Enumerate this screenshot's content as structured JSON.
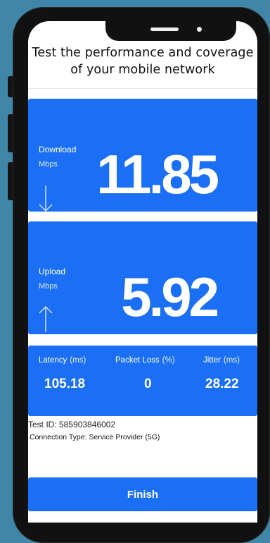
{
  "app": {
    "title": "Test the performance and coverage of your mobile network"
  },
  "download": {
    "label": "Download",
    "unit": "Mbps",
    "value": "11.85",
    "icon": "arrow-down-icon"
  },
  "upload": {
    "label": "Upload",
    "unit": "Mbps",
    "value": "5.92",
    "icon": "arrow-up-icon"
  },
  "stats": [
    {
      "label": "Latency",
      "unit": "(ms)",
      "value": "105.18"
    },
    {
      "label": "Packet Loss",
      "unit": "(%)",
      "value": "0"
    },
    {
      "label": "Jitter",
      "unit": "(ms)",
      "value": "28.22"
    }
  ],
  "info": {
    "test_id": "Test ID: 585903846002",
    "connection_type": "Connection Type: Service Provider (5G)"
  },
  "actions": {
    "finish_label": "Finish"
  },
  "colors": {
    "background": "#3f86a8",
    "accent": "#1a6ff5",
    "card_text": "#ffffff"
  }
}
